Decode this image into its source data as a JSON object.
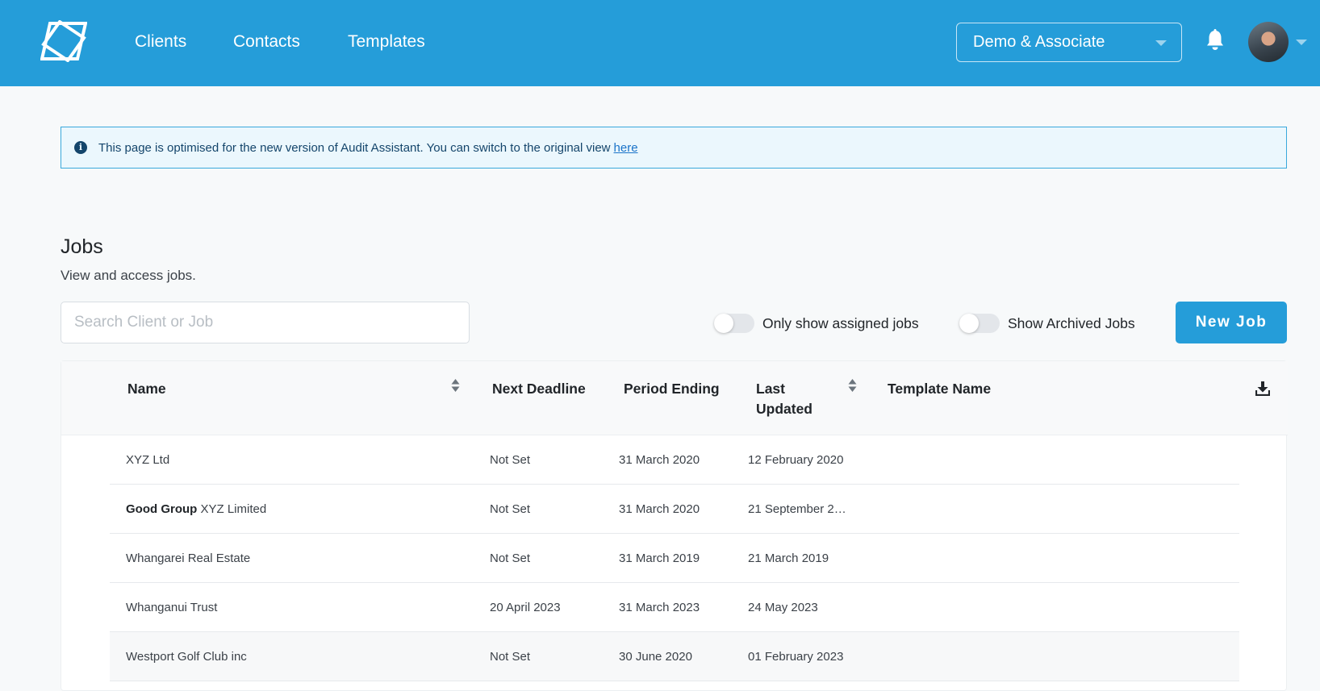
{
  "nav": {
    "links": [
      "Clients",
      "Contacts",
      "Templates"
    ],
    "org_selector": "Demo & Associate"
  },
  "banner": {
    "text": "This page is optimised for the new version of Audit Assistant. You can switch to the original view",
    "link": "here"
  },
  "jobs": {
    "title": "Jobs",
    "subtitle": "View and access jobs.",
    "search_placeholder": "Search Client or Job",
    "toggle_assigned": "Only show assigned jobs",
    "toggle_archived": "Show Archived Jobs",
    "new_job": "New Job"
  },
  "table": {
    "headers": {
      "name": "Name",
      "next_deadline": "Next Deadline",
      "period_ending": "Period Ending",
      "last_updated_1": "Last",
      "last_updated_2": "Updated",
      "template_name": "Template Name"
    },
    "rows": [
      {
        "group": "",
        "name": "XYZ Ltd",
        "next_deadline": "Not Set",
        "period_ending": "31 March 2020",
        "last_updated": "12 February 2020",
        "template_name": ""
      },
      {
        "group": "Good Group",
        "name": "XYZ Limited",
        "next_deadline": "Not Set",
        "period_ending": "31 March 2020",
        "last_updated": "21 September 2…",
        "template_name": ""
      },
      {
        "group": "",
        "name": "Whangarei Real Estate",
        "next_deadline": "Not Set",
        "period_ending": "31 March 2019",
        "last_updated": "21 March 2019",
        "template_name": ""
      },
      {
        "group": "",
        "name": "Whanganui Trust",
        "next_deadline": "20 April 2023",
        "period_ending": "31 March 2023",
        "last_updated": "24 May 2023",
        "template_name": ""
      },
      {
        "group": "",
        "name": "Westport Golf Club inc",
        "next_deadline": "Not Set",
        "period_ending": "30 June 2020",
        "last_updated": "01 February 2023",
        "template_name": ""
      }
    ]
  },
  "colors": {
    "brand": "#259dd9",
    "banner_bg": "#ebf7fd",
    "banner_border": "#3aa9dc",
    "page_bg": "#f7f9fa"
  },
  "icons": [
    "app-logo-icon",
    "chevron-down-icon",
    "bell-icon",
    "avatar",
    "info-icon",
    "sort-icon",
    "download-icon"
  ]
}
